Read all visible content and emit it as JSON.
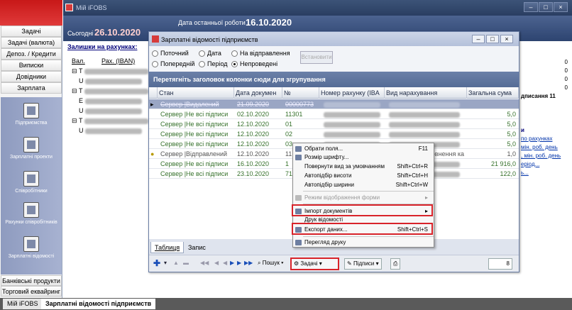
{
  "app": {
    "title": "Мій iFOBS"
  },
  "header": {
    "last_work_label": "Дата останньої роботи",
    "last_work_date": "16.10.2020",
    "today_label": "Сьогодні",
    "today_date": "26.10.2020"
  },
  "account": {
    "balances_link": "Залишки на рахунках:",
    "col_currency": "Вал.",
    "col_account": "Рах. (IBAN)",
    "groups": [
      "Т",
      "Т",
      "Т"
    ],
    "lines": [
      "U",
      "E",
      "U",
      "U"
    ]
  },
  "leftnav": {
    "items": [
      "Задачі",
      "Задачі (валюта)",
      "Депоз. / Кредити",
      "Виписки",
      "Довідники",
      "Зарплата"
    ],
    "icons": [
      {
        "label": "Підприємства",
        "icon": "building-icon"
      },
      {
        "label": "Зарплатні проекти",
        "icon": "salary-project-icon"
      },
      {
        "label": "Співробітники",
        "icon": "employees-icon"
      },
      {
        "label": "Рахунки співробітників",
        "icon": "employee-accounts-icon"
      },
      {
        "label": "Зарплатні відомості",
        "icon": "salary-statements-icon"
      }
    ],
    "bottom": [
      "Банківські продукти",
      "Торговий еквайринг"
    ]
  },
  "rightcol": {
    "lines": [
      "",
      "0",
      "0",
      "0",
      "0",
      "дписання   11",
      "",
      "",
      "",
      "и",
      "по рахунках",
      "мін. роб. день",
      ", мін. роб. день",
      "еріод...",
      "ь..."
    ]
  },
  "dialog": {
    "title": "Зарплатні відомості підприємств",
    "filters": {
      "current": "Поточний",
      "date": "Дата",
      "not_sent": "На відправлення",
      "previous": "Попередній",
      "period": "Період",
      "unprocessed": "Непроведені",
      "set_button": "Встановити"
    },
    "group_hint": "Перетягніть заголовок колонки сюди для згрупування",
    "columns": [
      "Стан",
      "Дата докумен",
      "№",
      "Номер рахунку (IBA",
      "Вид нарахування",
      "Загальна сума"
    ],
    "rows": [
      {
        "state": "Сервер |Видалений",
        "date": "21.09.2020",
        "num": "00000773",
        "sum": ""
      },
      {
        "state": "Сервер |Не всі підписи",
        "date": "02.10.2020",
        "num": "11301",
        "sum": "5,0"
      },
      {
        "state": "Сервер |Не всі підписи",
        "date": "12.10.2020",
        "num": "01",
        "sum": "5,0"
      },
      {
        "state": "Сервер |Не всі підписи",
        "date": "12.10.2020",
        "num": "02",
        "sum": "5,0"
      },
      {
        "state": "Сервер |Не всі підписи",
        "date": "12.10.2020",
        "num": "03",
        "sum": "5,0"
      },
      {
        "state": "Сервер |Відправлений",
        "date": "12.10.2020",
        "num": "11",
        "kind": "овнення ка",
        "sum": "1,0"
      },
      {
        "state": "Сервер |Не всі підписи",
        "date": "16.10.2020",
        "num": "1",
        "sum": "21 916,0"
      },
      {
        "state": "Сервер |Не всі підписи",
        "date": "23.10.2020",
        "num": "71",
        "sum": "122,0"
      }
    ],
    "tabs": [
      "Таблиця",
      "Запис"
    ],
    "toolbar": {
      "search": "Пошук",
      "tasks": "Задачі",
      "signatures": "Підписи",
      "count": "8"
    }
  },
  "menu": {
    "items": [
      {
        "label": "Обрати поля...",
        "shortcut": "F11"
      },
      {
        "label": "Розмір шрифту...",
        "shortcut": ""
      },
      {
        "label": "Повернути вид за умовчанням",
        "shortcut": "Shift+Ctrl+R"
      },
      {
        "label": "Автопідбір висоти",
        "shortcut": "Shift+Ctrl+H"
      },
      {
        "label": "Автопідбір ширини",
        "shortcut": "Shift+Ctrl+W"
      },
      {
        "label": "Режим відображення форми",
        "shortcut": ""
      },
      {
        "label": "Імпорт документів",
        "shortcut": ""
      },
      {
        "label": "Друк відомості",
        "shortcut": ""
      },
      {
        "label": "Експорт даних...",
        "shortcut": "Shift+Ctrl+S"
      },
      {
        "label": "Перегляд друку",
        "shortcut": ""
      }
    ]
  },
  "taskbar": {
    "items": [
      "Мій iFOBS",
      "Зарплатні відомості підприємств"
    ]
  }
}
